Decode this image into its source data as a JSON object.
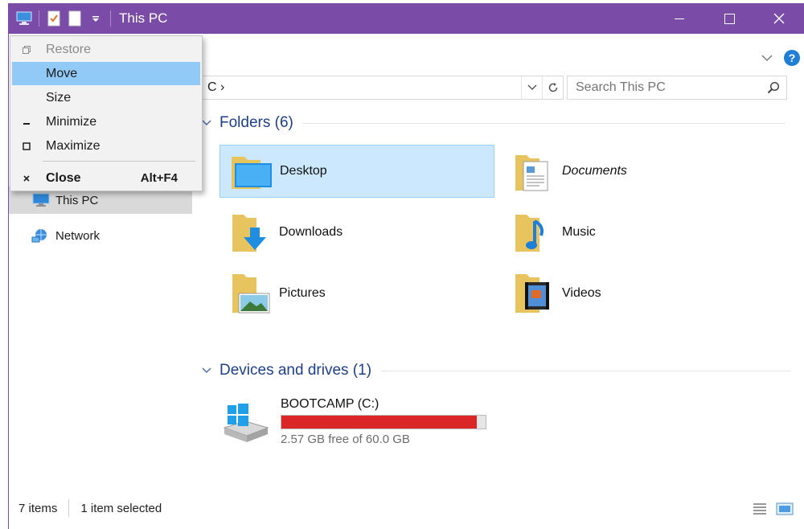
{
  "window": {
    "title": "This PC",
    "accent": "#7a4ca8"
  },
  "address": {
    "text": "C  ›"
  },
  "search": {
    "placeholder": "Search This PC"
  },
  "system_menu": {
    "items": [
      {
        "label": "Restore",
        "state": "disabled"
      },
      {
        "label": "Move",
        "state": "highlighted"
      },
      {
        "label": "Size",
        "state": "normal"
      },
      {
        "label": "Minimize",
        "state": "normal"
      },
      {
        "label": "Maximize",
        "state": "normal"
      },
      {
        "label": "Close",
        "accelerator": "Alt+F4",
        "state": "bold"
      }
    ]
  },
  "nav": {
    "items": [
      {
        "label": "This PC",
        "icon": "computer-icon",
        "selected": true
      },
      {
        "label": "Network",
        "icon": "network-icon",
        "selected": false
      }
    ]
  },
  "folders": {
    "header": "Folders (6)",
    "items": [
      {
        "label": "Desktop",
        "icon": "desktop-folder-icon",
        "selected": true
      },
      {
        "label": "Documents",
        "icon": "documents-folder-icon",
        "selected": false
      },
      {
        "label": "Downloads",
        "icon": "downloads-folder-icon",
        "selected": false
      },
      {
        "label": "Music",
        "icon": "music-folder-icon",
        "selected": false
      },
      {
        "label": "Pictures",
        "icon": "pictures-folder-icon",
        "selected": false
      },
      {
        "label": "Videos",
        "icon": "videos-folder-icon",
        "selected": false
      }
    ]
  },
  "devices": {
    "header": "Devices and drives (1)",
    "drives": [
      {
        "name": "BOOTCAMP (C:)",
        "free_text": "2.57 GB free of 60.0 GB",
        "used_fraction": 0.957,
        "bar_color": "#da2626"
      }
    ]
  },
  "status": {
    "item_count": "7 items",
    "selection": "1 item selected"
  }
}
